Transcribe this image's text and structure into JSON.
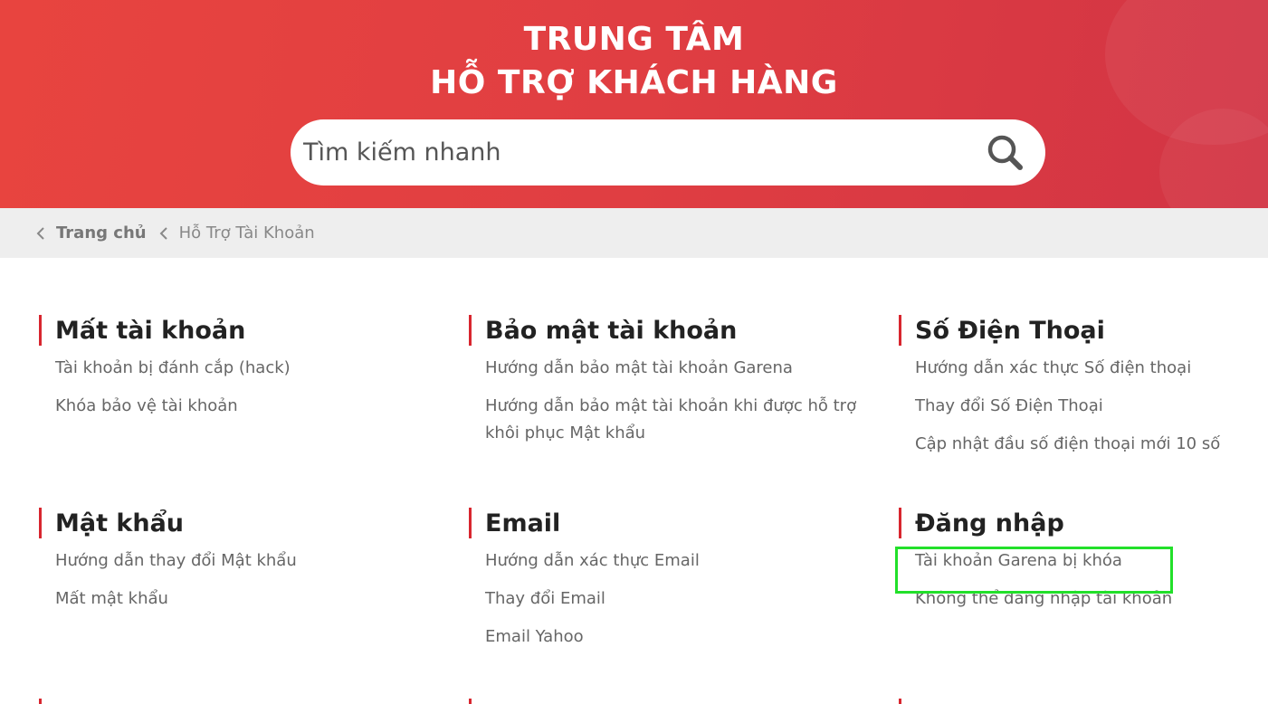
{
  "header": {
    "title_line1": "TRUNG TÂM",
    "title_line2": "HỖ TRỢ KHÁCH HÀNG",
    "brand_color": "#e03e42"
  },
  "search": {
    "placeholder": "Tìm kiếm nhanh",
    "icon": "search-icon"
  },
  "breadcrumb": {
    "home": "Trang chủ",
    "current": "Hỗ Trợ Tài Khoản"
  },
  "categories": [
    {
      "title": "Mất tài khoản",
      "links": [
        "Tài khoản bị đánh cắp (hack)",
        "Khóa bảo vệ tài khoản"
      ]
    },
    {
      "title": "Bảo mật tài khoản",
      "links": [
        "Hướng dẫn bảo mật tài khoản Garena",
        "Hướng dẫn bảo mật tài khoản khi được hỗ trợ khôi phục Mật khẩu"
      ]
    },
    {
      "title": "Số Điện Thoại",
      "links": [
        "Hướng dẫn xác thực Số điện thoại",
        "Thay đổi Số Điện Thoại",
        "Cập nhật đầu số điện thoại mới 10 số"
      ]
    },
    {
      "title": "Mật khẩu",
      "links": [
        "Hướng dẫn thay đổi Mật khẩu",
        "Mất mật khẩu"
      ]
    },
    {
      "title": "Email",
      "links": [
        "Hướng dẫn xác thực Email",
        "Thay đổi Email",
        "Email Yahoo"
      ]
    },
    {
      "title": "Đăng nhập",
      "links": [
        "Tài khoản Garena bị khóa",
        "Không thể đăng nhập tài khoản"
      ]
    }
  ],
  "highlight_color": "#22e02a"
}
